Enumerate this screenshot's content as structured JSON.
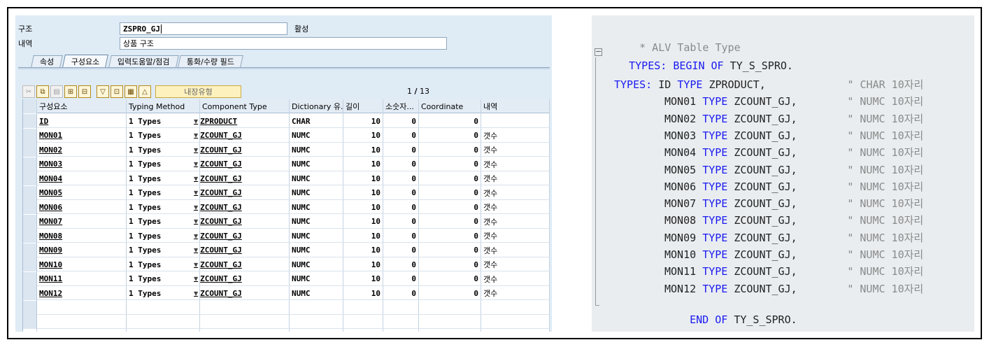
{
  "sap": {
    "structure_label": "구조",
    "structure_value": "ZSPRO_GJ",
    "status": "활성",
    "desc_label": "내역",
    "desc_value": "상품 구조",
    "tabs": [
      {
        "label": "속성",
        "active": false
      },
      {
        "label": "구성요소",
        "active": true
      },
      {
        "label": "입력도움말/점검",
        "active": false
      },
      {
        "label": "통화/수량 필드",
        "active": false
      }
    ],
    "toolbar": {
      "buttons": [
        "cut-icon",
        "copy-icon",
        "paste-icon",
        "insert-row-icon",
        "delete-row-icon",
        "filter-icon",
        "detail-icon",
        "table-icon",
        "up-icon"
      ],
      "builtin_type_label": "내장유형"
    },
    "pager": {
      "current": "1",
      "separator": "/",
      "total": "13"
    },
    "columns": [
      "구성요소",
      "Typing Method",
      "Component Type",
      "Dictionary 유...",
      "길이",
      "소숫자...",
      "Coordinate",
      "내역"
    ],
    "rows": [
      {
        "name": "ID",
        "method": "1 Types",
        "type": "ZPRODUCT",
        "dict": "CHAR",
        "len": "10",
        "dec": "0",
        "coord": "0",
        "desc": ""
      },
      {
        "name": "MON01",
        "method": "1 Types",
        "type": "ZCOUNT_GJ",
        "dict": "NUMC",
        "len": "10",
        "dec": "0",
        "coord": "0",
        "desc": "갯수"
      },
      {
        "name": "MON02",
        "method": "1 Types",
        "type": "ZCOUNT_GJ",
        "dict": "NUMC",
        "len": "10",
        "dec": "0",
        "coord": "0",
        "desc": "갯수"
      },
      {
        "name": "MON03",
        "method": "1 Types",
        "type": "ZCOUNT_GJ",
        "dict": "NUMC",
        "len": "10",
        "dec": "0",
        "coord": "0",
        "desc": "갯수"
      },
      {
        "name": "MON04",
        "method": "1 Types",
        "type": "ZCOUNT_GJ",
        "dict": "NUMC",
        "len": "10",
        "dec": "0",
        "coord": "0",
        "desc": "갯수"
      },
      {
        "name": "MON05",
        "method": "1 Types",
        "type": "ZCOUNT_GJ",
        "dict": "NUMC",
        "len": "10",
        "dec": "0",
        "coord": "0",
        "desc": "갯수"
      },
      {
        "name": "MON06",
        "method": "1 Types",
        "type": "ZCOUNT_GJ",
        "dict": "NUMC",
        "len": "10",
        "dec": "0",
        "coord": "0",
        "desc": "갯수"
      },
      {
        "name": "MON07",
        "method": "1 Types",
        "type": "ZCOUNT_GJ",
        "dict": "NUMC",
        "len": "10",
        "dec": "0",
        "coord": "0",
        "desc": "갯수"
      },
      {
        "name": "MON08",
        "method": "1 Types",
        "type": "ZCOUNT_GJ",
        "dict": "NUMC",
        "len": "10",
        "dec": "0",
        "coord": "0",
        "desc": "갯수"
      },
      {
        "name": "MON09",
        "method": "1 Types",
        "type": "ZCOUNT_GJ",
        "dict": "NUMC",
        "len": "10",
        "dec": "0",
        "coord": "0",
        "desc": "갯수"
      },
      {
        "name": "MON10",
        "method": "1 Types",
        "type": "ZCOUNT_GJ",
        "dict": "NUMC",
        "len": "10",
        "dec": "0",
        "coord": "0",
        "desc": "갯수"
      },
      {
        "name": "MON11",
        "method": "1 Types",
        "type": "ZCOUNT_GJ",
        "dict": "NUMC",
        "len": "10",
        "dec": "0",
        "coord": "0",
        "desc": "갯수"
      },
      {
        "name": "MON12",
        "method": "1 Types",
        "type": "ZCOUNT_GJ",
        "dict": "NUMC",
        "len": "10",
        "dec": "0",
        "coord": "0",
        "desc": "갯수"
      }
    ]
  },
  "code": {
    "comment": "* ALV Table Type",
    "begin": {
      "kw1": "TYPES:",
      "kw2": "BEGIN OF",
      "name": "TY_S_SPRO."
    },
    "fields_kw": "TYPES:",
    "fields": [
      {
        "name": "ID",
        "type": "ZPRODUCT,",
        "comment": "\" CHAR 10자리"
      },
      {
        "name": "MON01",
        "type": "ZCOUNT_GJ,",
        "comment": "\" NUMC 10자리"
      },
      {
        "name": "MON02",
        "type": "ZCOUNT_GJ,",
        "comment": "\" NUMC 10자리"
      },
      {
        "name": "MON03",
        "type": "ZCOUNT_GJ,",
        "comment": "\" NUMC 10자리"
      },
      {
        "name": "MON04",
        "type": "ZCOUNT_GJ,",
        "comment": "\" NUMC 10자리"
      },
      {
        "name": "MON05",
        "type": "ZCOUNT_GJ,",
        "comment": "\" NUMC 10자리"
      },
      {
        "name": "MON06",
        "type": "ZCOUNT_GJ,",
        "comment": "\" NUMC 10자리"
      },
      {
        "name": "MON07",
        "type": "ZCOUNT_GJ,",
        "comment": "\" NUMC 10자리"
      },
      {
        "name": "MON08",
        "type": "ZCOUNT_GJ,",
        "comment": "\" NUMC 10자리"
      },
      {
        "name": "MON09",
        "type": "ZCOUNT_GJ,",
        "comment": "\" NUMC 10자리"
      },
      {
        "name": "MON10",
        "type": "ZCOUNT_GJ,",
        "comment": "\" NUMC 10자리"
      },
      {
        "name": "MON11",
        "type": "ZCOUNT_GJ,",
        "comment": "\" NUMC 10자리"
      },
      {
        "name": "MON12",
        "type": "ZCOUNT_GJ,",
        "comment": "\" NUMC 10자리"
      }
    ],
    "type_kw": "TYPE",
    "end": {
      "kw": "END OF",
      "name": "TY_S_SPRO."
    },
    "fold_symbol": "−"
  }
}
